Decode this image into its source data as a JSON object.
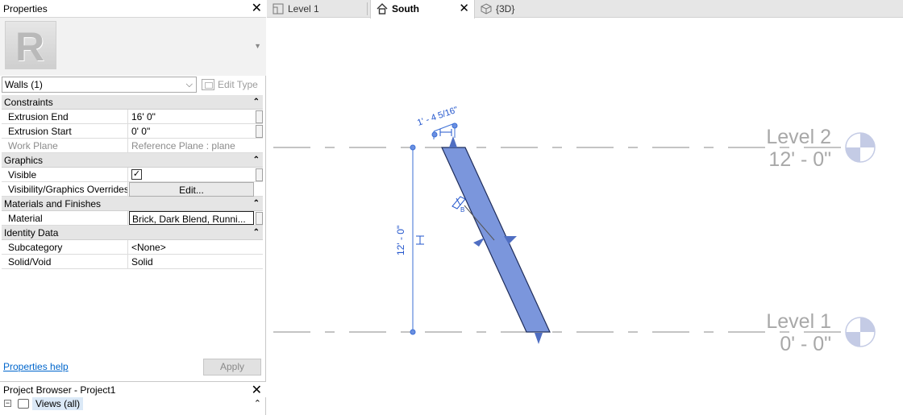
{
  "properties": {
    "title": "Properties",
    "selector": "Walls (1)",
    "edit_type": "Edit Type",
    "groups": [
      {
        "name": "Constraints",
        "rows": [
          {
            "label": "Extrusion End",
            "value": "16'  0\""
          },
          {
            "label": "Extrusion Start",
            "value": "0'  0\""
          },
          {
            "label": "Work Plane",
            "value": "Reference Plane : plane",
            "disabled": true
          }
        ]
      },
      {
        "name": "Graphics",
        "rows": [
          {
            "label": "Visible",
            "value": "✓"
          },
          {
            "label": "Visibility/Graphics Overrides",
            "value": "Edit..."
          }
        ]
      },
      {
        "name": "Materials and Finishes",
        "rows": [
          {
            "label": "Material",
            "value": "Brick, Dark Blend, Runni..."
          }
        ]
      },
      {
        "name": "Identity Data",
        "rows": [
          {
            "label": "Subcategory",
            "value": "<None>"
          },
          {
            "label": "Solid/Void",
            "value": "Solid"
          }
        ]
      }
    ],
    "help_link": "Properties help",
    "apply": "Apply"
  },
  "project_browser": {
    "title": "Project Browser - Project1",
    "tree_item": "Views (all)"
  },
  "tabs": [
    {
      "label": "Level 1",
      "icon": "floor-plan-icon"
    },
    {
      "label": "South",
      "icon": "elevation-icon",
      "active": true
    },
    {
      "label": "{3D}",
      "icon": "3d-view-icon"
    }
  ],
  "canvas": {
    "level2_name": "Level 2",
    "level2_elev": "12' - 0\"",
    "level1_name": "Level 1",
    "level1_elev": "0' - 0\"",
    "dim_vertical": "12' - 0\"",
    "dim_horizontal": "1' - 4 5/16\"",
    "element_color": "#7b96dc",
    "dim_color": "#2255cc"
  }
}
